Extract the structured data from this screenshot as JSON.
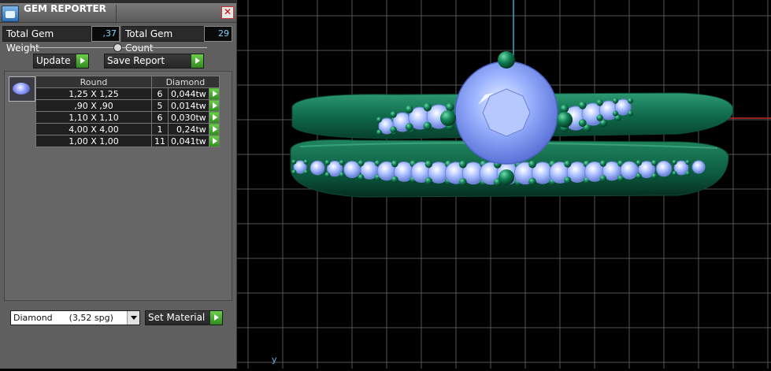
{
  "window": {
    "title": "GEM REPORTER",
    "close_glyph": "✕"
  },
  "summary": {
    "total_gem_weight_label": "Total Gem Weight",
    "total_gem_weight_value": ",37",
    "total_gem_count_label": "Total Gem Count",
    "total_gem_count_value": "29"
  },
  "buttons": {
    "update": "Update",
    "save_report": "Save Report",
    "set_material": "Set Material"
  },
  "gem_table": {
    "headers": [
      "Round",
      "Diamond"
    ],
    "rows": [
      {
        "size": "1,25 X 1,25",
        "count": "6",
        "weight": "0,044tw"
      },
      {
        "size": ",90 X ,90",
        "count": "5",
        "weight": "0,014tw"
      },
      {
        "size": "1,10 X 1,10",
        "count": "6",
        "weight": "0,030tw"
      },
      {
        "size": "4,00 X 4,00",
        "count": "1",
        "weight": "0,24tw"
      },
      {
        "size": "1,00 X 1,00",
        "count": "11",
        "weight": "0,041tw"
      }
    ]
  },
  "material": {
    "selected": "Diamond      (3,52 spg)"
  },
  "viewport": {
    "axis_label": "y",
    "colors": {
      "background": "#000000",
      "grid": "#5a5a5a",
      "metal": "#0f6a4c",
      "gem": "#7fa0f0",
      "axis_vertical": "#3aa7c7",
      "axis_horizontal": "#c02a2a"
    }
  }
}
